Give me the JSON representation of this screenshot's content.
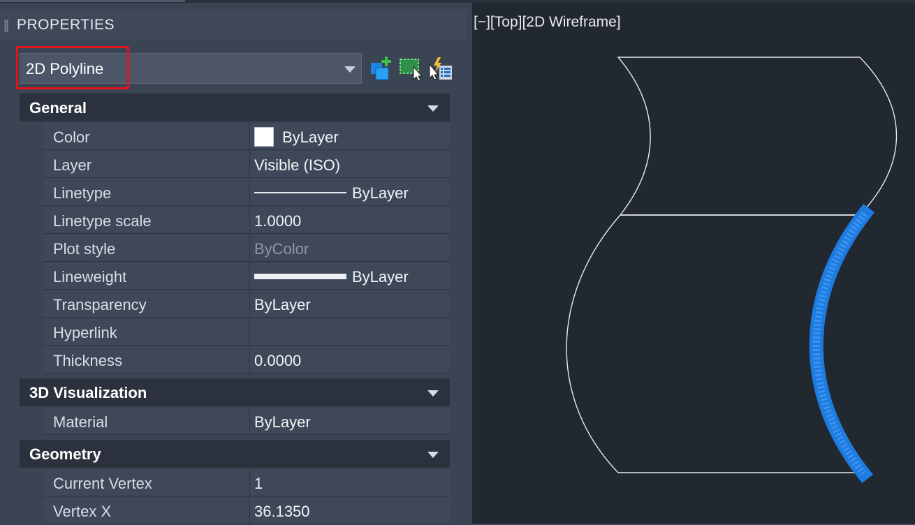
{
  "panel": {
    "title": "PROPERTIES"
  },
  "object_selector": {
    "value": "2D Polyline"
  },
  "toolbar": {
    "icons": [
      "toggle-pickadd-icon",
      "select-objects-icon",
      "quick-select-icon"
    ]
  },
  "sections": [
    {
      "title": "General",
      "rows": [
        {
          "name": "Color",
          "value": "ByLayer"
        },
        {
          "name": "Layer",
          "value": "Visible (ISO)"
        },
        {
          "name": "Linetype",
          "value": "ByLayer"
        },
        {
          "name": "Linetype scale",
          "value": "1.0000"
        },
        {
          "name": "Plot style",
          "value": "ByColor"
        },
        {
          "name": "Lineweight",
          "value": "ByLayer"
        },
        {
          "name": "Transparency",
          "value": "ByLayer"
        },
        {
          "name": "Hyperlink",
          "value": ""
        },
        {
          "name": "Thickness",
          "value": "0.0000"
        }
      ]
    },
    {
      "title": "3D Visualization",
      "rows": [
        {
          "name": "Material",
          "value": "ByLayer"
        }
      ]
    },
    {
      "title": "Geometry",
      "rows": [
        {
          "name": "Current Vertex",
          "value": "1"
        },
        {
          "name": "Vertex X",
          "value": "36.1350"
        }
      ]
    }
  ],
  "viewport": {
    "label": "[−][Top][2D Wireframe]"
  },
  "colors": {
    "selection": "#1e7ce0",
    "highlight_box": "#e1141c",
    "swatch": "#ffffff"
  }
}
